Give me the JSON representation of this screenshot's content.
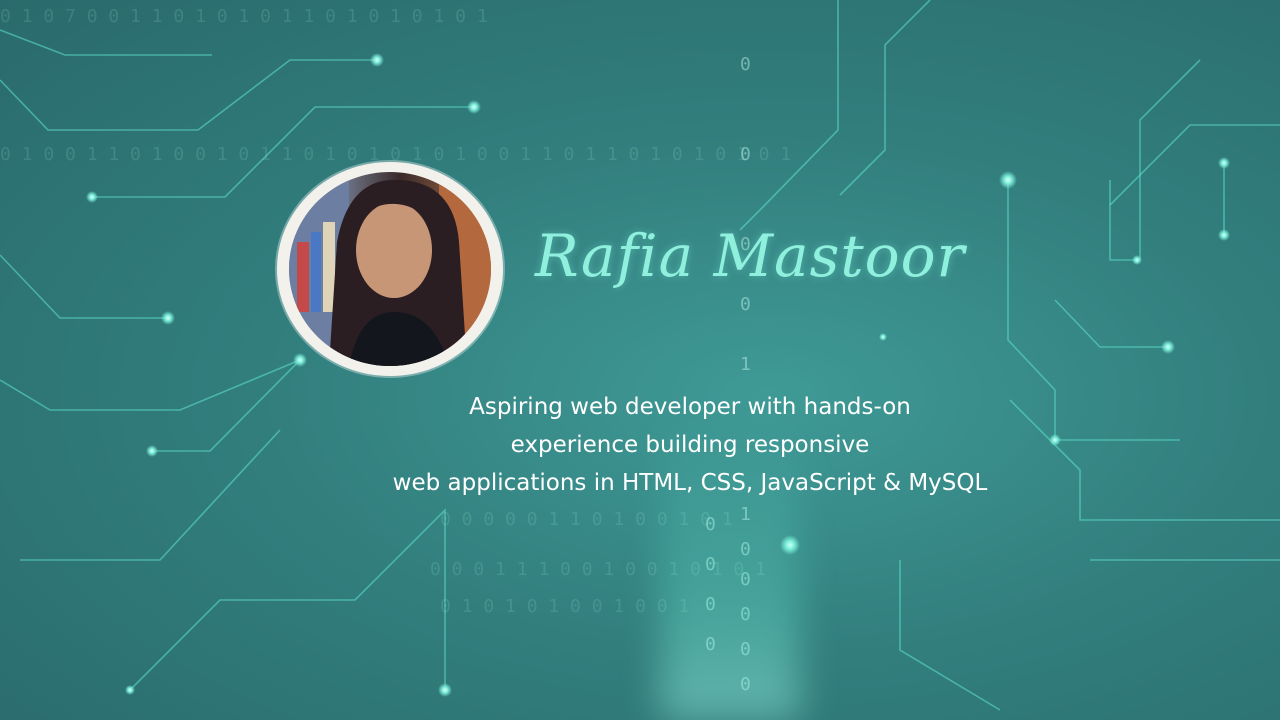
{
  "profile": {
    "name": "Rafia Mastoor",
    "tagline_lines": [
      "Aspiring web developer with hands-on",
      "experience building responsive",
      "web applications in HTML, CSS, JavaScript & MySQL"
    ]
  },
  "colors": {
    "background": "#327f7e",
    "name_color": "#8ff0de",
    "circuit": "#5fe3d0",
    "text": "#ffffff"
  },
  "icons": [
    "circuit-background",
    "profile-photo"
  ]
}
